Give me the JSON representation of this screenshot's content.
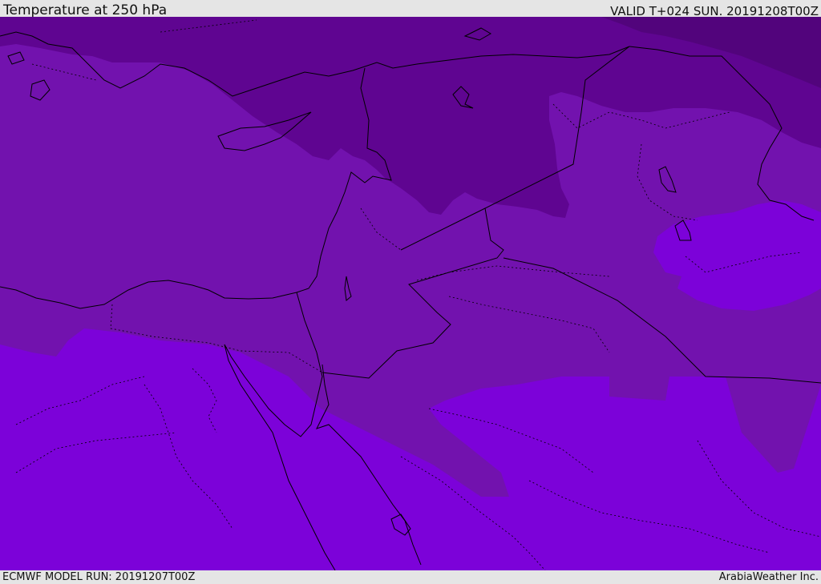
{
  "header": {
    "title": "Temperature at 250 hPa",
    "valid": "VALID T+024 SUN. 20191208T00Z"
  },
  "footer": {
    "model_run": "ECMWF MODEL RUN: 20191207T00Z",
    "credit": "ArabiaWeather Inc."
  },
  "map": {
    "colors": {
      "darkest": "#52047c",
      "dark": "#5f0591",
      "medium": "#7212ae",
      "light": "#7c02d9",
      "border": "#000000"
    }
  }
}
